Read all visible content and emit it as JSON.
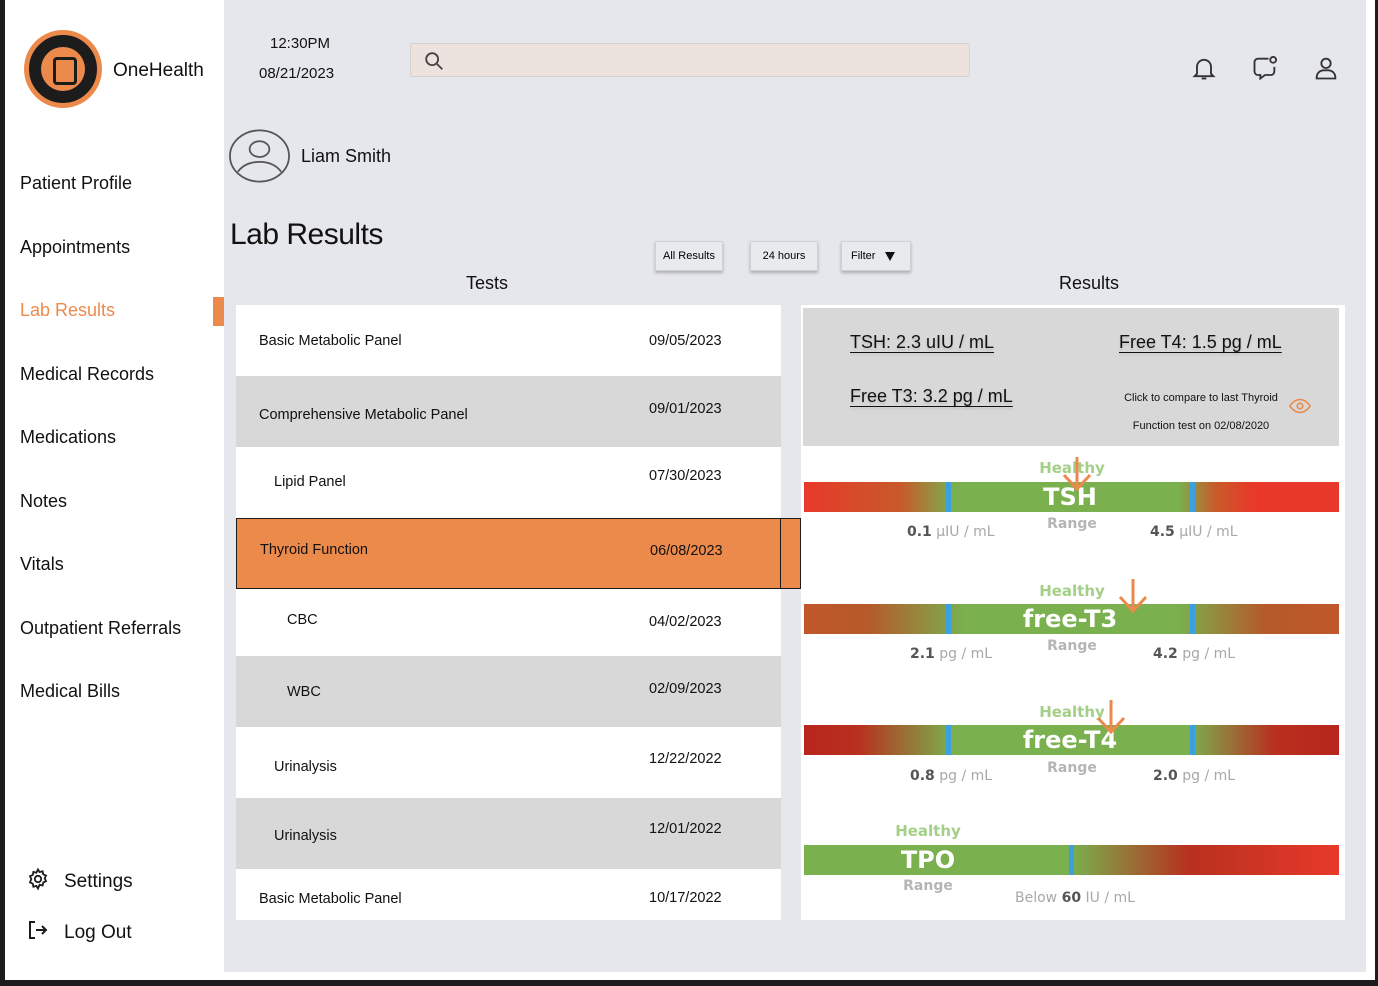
{
  "app": {
    "name": "OneHealth",
    "logo_text": "ONE HEALTH"
  },
  "header": {
    "time": "12:30PM",
    "date": "08/21/2023",
    "search_placeholder": ""
  },
  "patient": {
    "name": "Liam Smith"
  },
  "sidebar": {
    "items": [
      {
        "label": "Patient Profile"
      },
      {
        "label": "Appointments"
      },
      {
        "label": "Lab Results"
      },
      {
        "label": "Medical Records"
      },
      {
        "label": "Medications"
      },
      {
        "label": "Notes"
      },
      {
        "label": "Vitals"
      },
      {
        "label": "Outpatient Referrals"
      },
      {
        "label": "Medical Bills"
      }
    ],
    "active": "Lab Results",
    "settings": "Settings",
    "logout": "Log Out"
  },
  "page": {
    "title": "Lab Results",
    "buttons": {
      "all": "All Results",
      "day": "24 hours",
      "filter": "Filter"
    },
    "tests_heading": "Tests",
    "results_heading": "Results"
  },
  "tests": [
    {
      "name": "Basic Metabolic Panel",
      "date": "09/05/2023"
    },
    {
      "name": "Comprehensive Metabolic Panel",
      "date": "09/01/2023"
    },
    {
      "name": "Lipid Panel",
      "date": "07/30/2023"
    },
    {
      "name": "Thyroid Function",
      "date": "06/08/2023",
      "selected": true
    },
    {
      "name": "CBC",
      "date": "04/02/2023"
    },
    {
      "name": "WBC",
      "date": "02/09/2023"
    },
    {
      "name": "Urinalysis",
      "date": "12/22/2022"
    },
    {
      "name": "Urinalysis",
      "date": "12/01/2022"
    },
    {
      "name": "Basic Metabolic Panel",
      "date": "10/17/2022"
    }
  ],
  "results": {
    "tsh": "TSH: 2.3 uIU / mL",
    "free_t4": "Free T4: 1.5 pg / mL",
    "free_t3": "Free T3: 3.2 pg / mL",
    "compare_line1": "Click to compare to last Thyroid",
    "compare_line2": "Function test on 02/08/2020"
  },
  "gauges": {
    "healthy": "Healthy",
    "range": "Range",
    "tsh": {
      "label": "TSH",
      "low": "0.1",
      "low_unit": "µIU / mL",
      "high": "4.5",
      "high_unit": "µIU / mL"
    },
    "t3": {
      "label": "free-T3",
      "low": "2.1",
      "low_unit": "pg / mL",
      "high": "4.2",
      "high_unit": "pg / mL"
    },
    "t4": {
      "label": "free-T4",
      "low": "0.8",
      "low_unit": "pg / mL",
      "high": "2.0",
      "high_unit": "pg / mL"
    },
    "tpo": {
      "label": "TPO",
      "below": "Below",
      "value": "60",
      "unit": "IU / mL"
    }
  },
  "colors": {
    "accent": "#ec8a4c",
    "main_bg": "#e6e7ec",
    "healthy": "#7ab04e",
    "marker": "#3aa0e0"
  }
}
